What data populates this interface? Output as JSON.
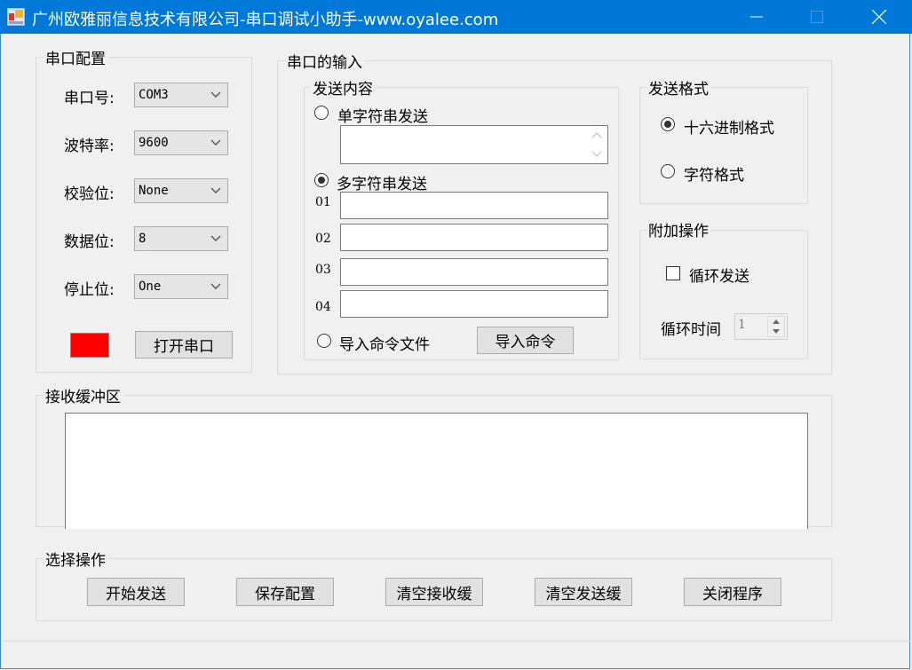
{
  "window": {
    "title": "广州欧雅丽信息技术有限公司-串口调试小助手-www.oyalee.com",
    "controls": [
      "minimize",
      "maximize",
      "close"
    ],
    "accent_color": "#0078d7"
  },
  "serial_config": {
    "group_label": "串口配置",
    "fields": [
      {
        "label": "串口号:",
        "value": "COM3"
      },
      {
        "label": "波特率:",
        "value": "9600"
      },
      {
        "label": "校验位:",
        "value": "None"
      },
      {
        "label": "数据位:",
        "value": "8"
      },
      {
        "label": "停止位:",
        "value": "One"
      }
    ],
    "status_indicator_color": "#ff0000",
    "open_button_label": "打开串口"
  },
  "serial_input": {
    "group_label": "串口的输入",
    "send_content": {
      "group_label": "发送内容",
      "single_radio_label": "单字符串发送",
      "single_selected": false,
      "single_text": "",
      "multi_radio_label": "多字符串发送",
      "multi_selected": true,
      "rows": [
        {
          "num": "01",
          "value": ""
        },
        {
          "num": "02",
          "value": ""
        },
        {
          "num": "03",
          "value": ""
        },
        {
          "num": "04",
          "value": ""
        }
      ],
      "import_radio_label": "导入命令文件",
      "import_selected": false,
      "import_button_label": "导入命令"
    },
    "send_format": {
      "group_label": "发送格式",
      "hex_label": "十六进制格式",
      "hex_selected": true,
      "char_label": "字符格式",
      "char_selected": false
    },
    "extra_ops": {
      "group_label": "附加操作",
      "loop_send_label": "循环发送",
      "loop_send_checked": false,
      "loop_time_label": "循环时间",
      "loop_time_value": "1"
    }
  },
  "receive_buffer": {
    "group_label": "接收缓冲区",
    "content": ""
  },
  "operations": {
    "group_label": "选择操作",
    "buttons": [
      "开始发送",
      "保存配置",
      "清空接收缓",
      "清空发送缓",
      "关闭程序"
    ]
  }
}
